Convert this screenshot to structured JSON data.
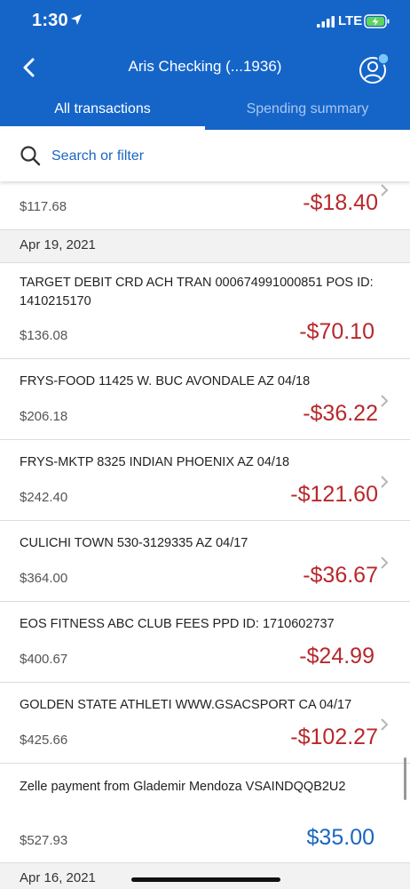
{
  "status": {
    "time": "1:30",
    "network": "LTE"
  },
  "nav": {
    "title": "Aris Checking  (...1936)"
  },
  "tabs": [
    {
      "label": "All transactions",
      "active": true
    },
    {
      "label": "Spending summary",
      "active": false
    }
  ],
  "search": {
    "placeholder": "Search or filter"
  },
  "colors": {
    "brand": "#1565c9",
    "debit": "#b7282c",
    "credit": "#1a66c0"
  },
  "transactions": {
    "t0": {
      "balance": "$117.68",
      "amount": "-$18.40"
    },
    "date1": "Apr 19, 2021",
    "t1": {
      "desc": "TARGET DEBIT CRD ACH TRAN 000674991000851 POS ID: 1410215170",
      "balance": "$136.08",
      "amount": "-$70.10"
    },
    "t2": {
      "desc": "FRYS-FOOD 11425 W. BUC AVONDALE AZ 04/18",
      "balance": "$206.18",
      "amount": "-$36.22"
    },
    "t3": {
      "desc": "FRYS-MKTP 8325 INDIAN PHOENIX AZ 04/18",
      "balance": "$242.40",
      "amount": "-$121.60"
    },
    "t4": {
      "desc": "CULICHI TOWN 530-3129335 AZ 04/17",
      "balance": "$364.00",
      "amount": "-$36.67"
    },
    "t5": {
      "desc": "EOS FITNESS ABC CLUB FEES PPD ID: 1710602737",
      "balance": "$400.67",
      "amount": "-$24.99"
    },
    "t6": {
      "desc": "GOLDEN STATE ATHLETI WWW.GSACSPORT CA 04/17",
      "balance": "$425.66",
      "amount": "-$102.27"
    },
    "t7": {
      "desc": "Zelle payment from Glademir Mendoza VSAINDQQB2U2",
      "balance": "$527.93",
      "amount": "$35.00"
    },
    "date2": "Apr 16, 2021"
  }
}
